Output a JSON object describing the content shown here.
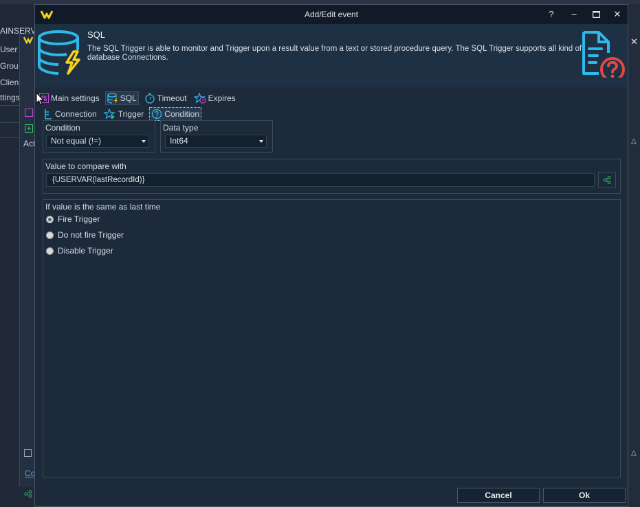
{
  "background": {
    "labels": [
      "AINSERVE",
      "User",
      "Grou",
      "Clien",
      "ttings",
      "Act",
      "Co"
    ]
  },
  "dialog": {
    "title": "Add/Edit event",
    "titlebar_buttons": {
      "help": "?",
      "minimize": "–",
      "maximize": "☐",
      "close": "✕"
    },
    "header": {
      "title": "SQL",
      "description": "The SQL Trigger is able to monitor and Trigger upon a result value from a text or stored procedure query. The SQL Trigger supports all kind of database Connections."
    },
    "tabs_row1": [
      {
        "label": "Main settings",
        "icon": "sliders-icon"
      },
      {
        "label": "SQL",
        "icon": "database-bolt-icon"
      },
      {
        "label": "Timeout",
        "icon": "stopwatch-icon"
      },
      {
        "label": "Expires",
        "icon": "star-clock-icon"
      }
    ],
    "tabs_row2": [
      {
        "label": "Connection",
        "icon": "plug-icon"
      },
      {
        "label": "Trigger",
        "icon": "star-play-icon"
      },
      {
        "label": "Condition",
        "icon": "question-circle-icon"
      }
    ],
    "condition": {
      "label": "Condition",
      "value": "Not equal (!=)"
    },
    "data_type": {
      "label": "Data type",
      "value": "Int64"
    },
    "value_compare": {
      "label": "Value to compare with",
      "value": "{USERVAR(lastRecordId)}"
    },
    "same_value": {
      "label": "If value is the same as last time",
      "options": [
        "Fire Trigger",
        "Do not fire Trigger",
        "Disable Trigger"
      ],
      "selected": "Fire Trigger"
    },
    "buttons": {
      "cancel": "Cancel",
      "ok": "Ok"
    },
    "colors": {
      "accent_cyan": "#2fb8e8",
      "accent_yellow": "#f2d21b",
      "accent_red": "#e04848",
      "accent_magenta": "#c04ad8"
    }
  }
}
